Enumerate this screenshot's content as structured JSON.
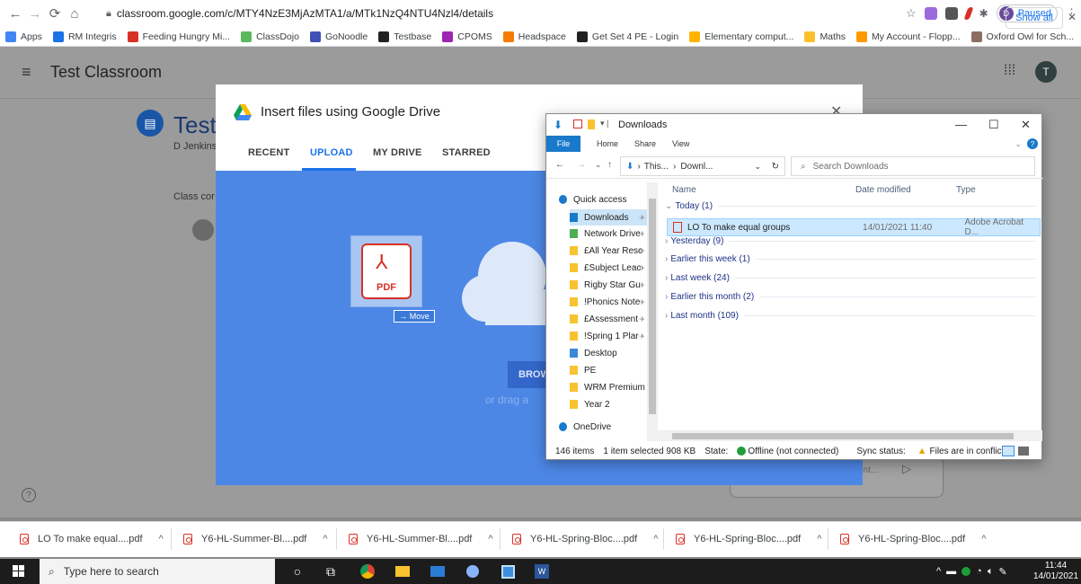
{
  "browser": {
    "url": "classroom.google.com/c/MTY4NzE3MjAzMTA1/a/MTk1NzQ4NTU4Nzl4/details",
    "profile_initial": "D",
    "profile_status": "Paused"
  },
  "bookmarks": [
    {
      "label": "Apps",
      "color": "#4285f4"
    },
    {
      "label": "RM Integris",
      "color": "#1a73e8"
    },
    {
      "label": "Feeding Hungry Mi...",
      "color": "#d93025"
    },
    {
      "label": "ClassDojo",
      "color": "#5cb85c"
    },
    {
      "label": "GoNoodle",
      "color": "#3f51b5"
    },
    {
      "label": "Testbase",
      "color": "#222222"
    },
    {
      "label": "CPOMS",
      "color": "#9c27b0"
    },
    {
      "label": "Headspace",
      "color": "#f57c00"
    },
    {
      "label": "Get Set 4 PE - Login",
      "color": "#212121"
    },
    {
      "label": "Elementary comput...",
      "color": "#ffb300"
    },
    {
      "label": "Maths",
      "color": "#fbc02d"
    },
    {
      "label": "My Account - Flopp...",
      "color": "#ff9800"
    },
    {
      "label": "Oxford Owl for Sch...",
      "color": "#8d6e63"
    },
    {
      "label": "»",
      "color": ""
    }
  ],
  "classroom": {
    "title": "Test Classroom",
    "assignment_title": "Test",
    "author": "D Jenkins",
    "class_comments": "Class cor",
    "avatar_initial": "T",
    "reply_placeholder": "ent..."
  },
  "drive_dialog": {
    "title": "Insert files using Google Drive",
    "tabs": [
      "RECENT",
      "UPLOAD",
      "MY DRIVE",
      "STARRED"
    ],
    "active_tab": "UPLOAD",
    "browse_label": "BROW",
    "drag_text": "or drag a",
    "pdf_label": "PDF",
    "move_tip": "→ Move",
    "accent": "#1a73e8"
  },
  "explorer": {
    "title": "Downloads",
    "ribbon": [
      "File",
      "Home",
      "Share",
      "View"
    ],
    "address": [
      "This...",
      "Downl..."
    ],
    "search_placeholder": "Search Downloads",
    "nav": [
      {
        "label": "Quick access",
        "type": "star"
      },
      {
        "label": "Downloads",
        "type": "download",
        "pinned": true,
        "selected": true
      },
      {
        "label": "Network Drive",
        "type": "net",
        "pinned": true
      },
      {
        "label": "£All Year Resc",
        "type": "folder",
        "pinned": true
      },
      {
        "label": "£Subject Leac",
        "type": "folder",
        "pinned": true
      },
      {
        "label": "Rigby Star Gu",
        "type": "folder",
        "pinned": true
      },
      {
        "label": "!Phonics Note",
        "type": "folder",
        "pinned": true
      },
      {
        "label": "£Assessment",
        "type": "folder",
        "pinned": true
      },
      {
        "label": "!Spring 1 Plar",
        "type": "folder",
        "pinned": true
      },
      {
        "label": "Desktop",
        "type": "desktop"
      },
      {
        "label": "PE",
        "type": "folder"
      },
      {
        "label": "WRM Premium",
        "type": "folder"
      },
      {
        "label": "Year 2",
        "type": "folder"
      },
      {
        "label": "OneDrive",
        "type": "cloud"
      }
    ],
    "columns": [
      "Name",
      "Date modified",
      "Type"
    ],
    "groups": [
      {
        "label": "Today (1)",
        "open": true
      },
      {
        "label": "Yesterday (9)"
      },
      {
        "label": "Earlier this week (1)"
      },
      {
        "label": "Last week (24)"
      },
      {
        "label": "Earlier this month (2)"
      },
      {
        "label": "Last month (109)"
      }
    ],
    "file": {
      "name": "LO To make equal groups",
      "date": "14/01/2021 11:40",
      "type": "Adobe Acrobat D..."
    },
    "status": {
      "items": "146 items",
      "selected": "1 item selected  908 KB",
      "state": "State:",
      "offline": "Offline (not connected)",
      "sync": "Sync status:",
      "conflict": "Files are in conflict"
    }
  },
  "downloads": [
    "LO To make equal....pdf",
    "Y6-HL-Summer-Bl....pdf",
    "Y6-HL-Summer-Bl....pdf",
    "Y6-HL-Spring-Bloc....pdf",
    "Y6-HL-Spring-Bloc....pdf",
    "Y6-HL-Spring-Bloc....pdf"
  ],
  "show_all": "Show all",
  "taskbar": {
    "search_placeholder": "Type here to search",
    "time": "11:44",
    "date": "14/01/2021"
  }
}
